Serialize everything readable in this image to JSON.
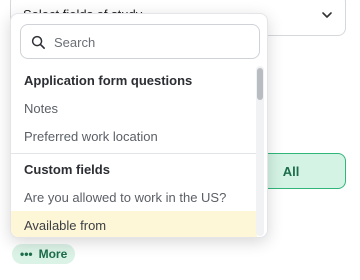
{
  "background": {
    "select_text": "Select fields of study",
    "all_button": "All",
    "more_chip": {
      "dots": "•••",
      "label": "More"
    }
  },
  "dropdown": {
    "search": {
      "placeholder": "Search",
      "value": ""
    },
    "groups": [
      {
        "header": "Application form questions",
        "options": [
          "Notes",
          "Preferred work location"
        ]
      },
      {
        "header": "Custom fields",
        "options": [
          "Are you allowed to work in the US?",
          "Available from"
        ]
      }
    ],
    "highlighted_option": "Available from"
  },
  "colors": {
    "accent_green": "#30b67a",
    "accent_green_bg": "#d4f3e4",
    "highlight_bg": "#fdf6d7"
  }
}
